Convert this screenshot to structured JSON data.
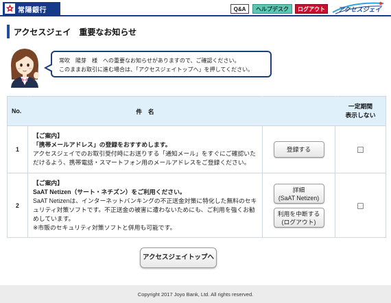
{
  "header": {
    "bank_name": "常陽銀行",
    "qa_label": "Q&A",
    "helpdesk_label": "ヘルプデスク",
    "logout_label": "ログアウト",
    "service_logo_text": "アクセスジェイ",
    "colors": {
      "navy": "#17398a",
      "helpdesk": "#5cc8b4",
      "logout": "#c8102e",
      "title_accent": "#1d4f9c"
    }
  },
  "page_title": "アクセスジェイ　重要なお知らせ",
  "notice_message": {
    "line1": "常吹　陽芽　様　への重要なお知らせがありますので、ご確認ください。",
    "line2": "このままお取引に進む場合は、「アクセスジェイトップへ」を押してください。"
  },
  "table": {
    "headers": {
      "no": "No.",
      "subject": "件　名",
      "hide_line1": "一定期間",
      "hide_line2": "表示しない"
    },
    "rows": [
      {
        "no": "1",
        "tag": "【ご案内】",
        "title": "「携帯メールアドレス」の登録をおすすめします。",
        "body": [
          "アクセスジェイでのお取引受付時にお送りする「通知メール」をすぐにご確認いた",
          "だけるよう、携帯電話・スマートフォン用のメールアドレスをご登録ください。"
        ],
        "actions": [
          {
            "label": "登録する"
          }
        ],
        "hide_checked": false
      },
      {
        "no": "2",
        "tag": "【ご案内】",
        "title": "SaAT Netizen（サート・ネチズン）をご利用ください。",
        "body": [
          "SaAT Netizenは、インターネットバンキングの不正送金対策に特化した無料のセキ",
          "ュリティ対策ソフトです。不正送金の被害に遭わないためにも、ご利用を強くお勧",
          "めしています。",
          "※市販のセキュリティ対策ソフトと併用も可能です。"
        ],
        "actions": [
          {
            "line1": "詳細",
            "line2": "(SaAT Netizen)"
          },
          {
            "line1": "利用を中断する",
            "line2": "(ログアウト)"
          }
        ],
        "hide_checked": false
      }
    ]
  },
  "top_button_label": "アクセスジェイトップへ",
  "footer": {
    "copyright": "Copyright 2017 Joyo Bank, Ltd. All rights reserved."
  }
}
